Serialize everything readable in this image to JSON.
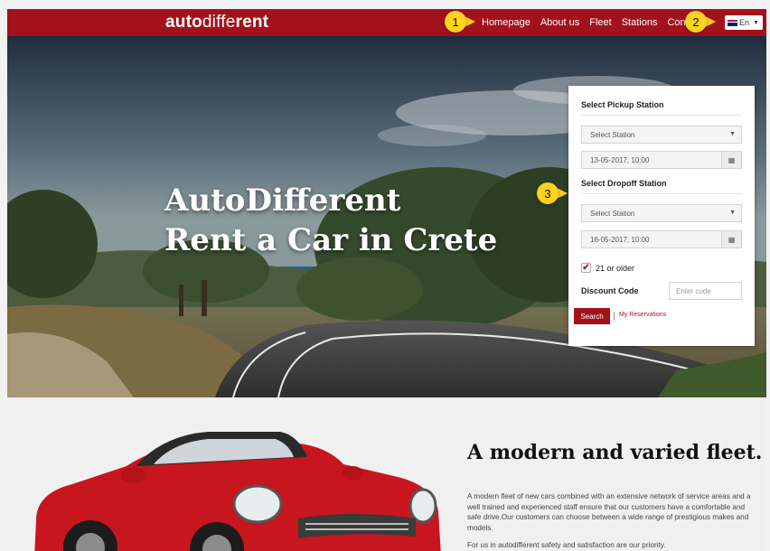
{
  "header": {
    "logo_bold_1": "auto",
    "logo_thin": "diffe",
    "logo_bold_2": "rent",
    "nav": [
      "Homepage",
      "About us",
      "Fleet",
      "Stations",
      "Contact"
    ],
    "language": "En"
  },
  "markers": [
    "1",
    "2",
    "3"
  ],
  "hero": {
    "title_line1": "AutoDifferent",
    "title_line2": "Rent a Car in Crete"
  },
  "booking": {
    "pickup_heading": "Select Pickup Station",
    "pickup_station": "Select Station",
    "pickup_datetime": "13-05-2017, 10:00",
    "dropoff_heading": "Select Dropoff Station",
    "dropoff_station": "Select Station",
    "dropoff_datetime": "16-05-2017, 10:00",
    "age_checkbox_label": "21 or older",
    "age_checked": true,
    "discount_label": "Discount Code",
    "discount_placeholder": "Enter code",
    "search_button": "Search",
    "my_reservations": "My Reservations"
  },
  "fleet": {
    "title": "A modern and varied fleet.",
    "paragraph": "A modern fleet of new cars combined with an extensive network of service areas and a well trained and experienced staff ensure that our customers have a comfortable and safe drive.Our customers can choose between a wide range of prestigious makes and models.",
    "paragraph2": "For us in autodifferent  safety and satisfaction are our priority."
  },
  "colors": {
    "brand_red": "#a3121c",
    "marker_yellow": "#ffd21f"
  }
}
